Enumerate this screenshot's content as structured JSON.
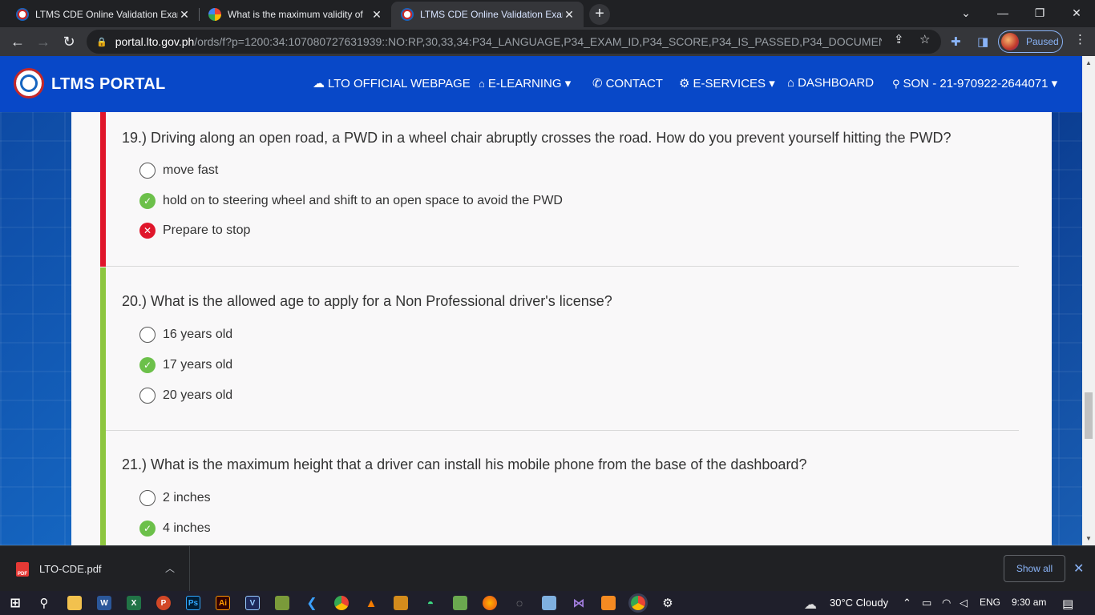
{
  "browser": {
    "tabs": [
      {
        "title": "LTMS CDE Online Validation Exam",
        "active": false
      },
      {
        "title": "What is the maximum validity of",
        "active": false
      },
      {
        "title": "LTMS CDE Online Validation Exam",
        "active": true
      }
    ],
    "new_tab": "+",
    "window_controls": {
      "dropdown": "⌄",
      "minimize": "—",
      "restore": "❐",
      "close": "✕"
    },
    "url_host": "portal.lto.gov.ph",
    "url_path": "/ords/f?p=1200:34:107080727631939::NO:RP,30,33,34:P34_LANGUAGE,P34_EXAM_ID,P34_SCORE,P34_IS_PASSED,P34_DOCUMENT_FK,P34...",
    "profile_label": "Paused"
  },
  "portal": {
    "brand": "LTMS PORTAL",
    "nav": [
      {
        "icon": "☁",
        "label": "LTO OFFICIAL WEBPAGE",
        "caret": ""
      },
      {
        "icon": "🎓",
        "label": "E-LEARNING",
        "caret": "▾"
      },
      {
        "icon": "✆",
        "label": "CONTACT",
        "caret": ""
      },
      {
        "icon": "⚙",
        "label": "E-SERVICES",
        "caret": "▾"
      },
      {
        "icon": "⌂",
        "label": "DASHBOARD",
        "caret": ""
      },
      {
        "icon": "👤",
        "label": "SON - 21-970922-2644071",
        "caret": "▾"
      }
    ]
  },
  "questions": [
    {
      "text": "19.) Driving along an open road, a PWD in a wheel chair abruptly crosses the road. How do you prevent yourself hitting the PWD?",
      "status": "wrong",
      "options": [
        {
          "label": "move fast",
          "state": "none"
        },
        {
          "label": "hold on to steering wheel and shift to an open space to avoid the PWD",
          "state": "correct"
        },
        {
          "label": "Prepare to stop",
          "state": "incorrect"
        }
      ]
    },
    {
      "text": "20.) What is the allowed age to apply for a Non Professional driver's license?",
      "status": "right",
      "options": [
        {
          "label": "16 years old",
          "state": "none"
        },
        {
          "label": "17 years old",
          "state": "correct"
        },
        {
          "label": "20 years old",
          "state": "none"
        }
      ]
    },
    {
      "text": "21.) What is the maximum height that a driver can install his mobile phone from the base of the dashboard?",
      "status": "right",
      "options": [
        {
          "label": "2 inches",
          "state": "none"
        },
        {
          "label": "4 inches",
          "state": "correct"
        }
      ]
    }
  ],
  "download_bar": {
    "file": "LTO-CDE.pdf",
    "show_all": "Show all"
  },
  "taskbar": {
    "weather": "30°C  Cloudy",
    "lang": "ENG",
    "time": "9:30 am"
  },
  "colors": {
    "portal_nav": "#0848c8",
    "wrong": "#e0162b",
    "right": "#8dc63f",
    "check": "#6cc04a"
  }
}
